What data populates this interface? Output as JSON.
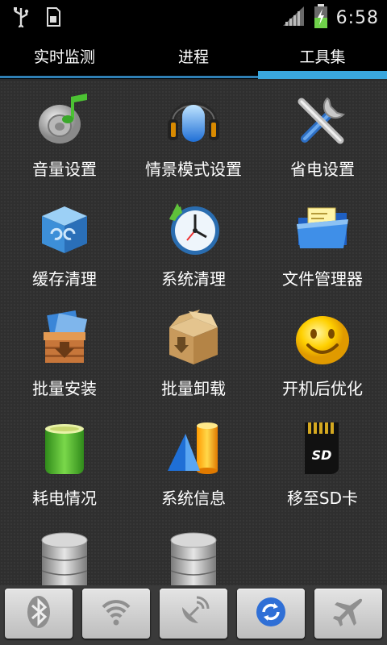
{
  "status_bar": {
    "time": "6:58",
    "left_icons": [
      "usb-icon",
      "sd-card-icon"
    ],
    "right_icons": [
      "signal-icon",
      "battery-charging-icon"
    ]
  },
  "tabs": [
    {
      "label": "实时监测",
      "active": false
    },
    {
      "label": "进程",
      "active": false
    },
    {
      "label": "工具集",
      "active": true
    }
  ],
  "tools": [
    {
      "label": "音量设置",
      "icon": "volume-icon"
    },
    {
      "label": "情景模式设置",
      "icon": "headphones-icon"
    },
    {
      "label": "省电设置",
      "icon": "tools-icon"
    },
    {
      "label": "缓存清理",
      "icon": "recycle-box-icon"
    },
    {
      "label": "系统清理",
      "icon": "clock-clean-icon"
    },
    {
      "label": "文件管理器",
      "icon": "folder-icon"
    },
    {
      "label": "批量安装",
      "icon": "install-box-icon"
    },
    {
      "label": "批量卸载",
      "icon": "uninstall-box-icon"
    },
    {
      "label": "开机后优化",
      "icon": "smiley-icon"
    },
    {
      "label": "耗电情况",
      "icon": "battery-icon"
    },
    {
      "label": "系统信息",
      "icon": "chart-shapes-icon"
    },
    {
      "label": "移至SD卡",
      "icon": "sd-card-icon"
    },
    {
      "label": "",
      "icon": "database-icon"
    },
    {
      "label": "",
      "icon": "database-icon"
    }
  ],
  "toggles": [
    {
      "icon": "bluetooth-icon",
      "active": false
    },
    {
      "icon": "wifi-icon",
      "active": false
    },
    {
      "icon": "gps-icon",
      "active": false
    },
    {
      "icon": "sync-icon",
      "active": true
    },
    {
      "icon": "airplane-icon",
      "active": false
    }
  ],
  "colors": {
    "accent": "#3aa7dd",
    "tab_background": "#000000",
    "grid_background": "#2f2f2f",
    "active_toggle": "#2f6fd6",
    "inactive_toggle": "#8f8f8f"
  }
}
